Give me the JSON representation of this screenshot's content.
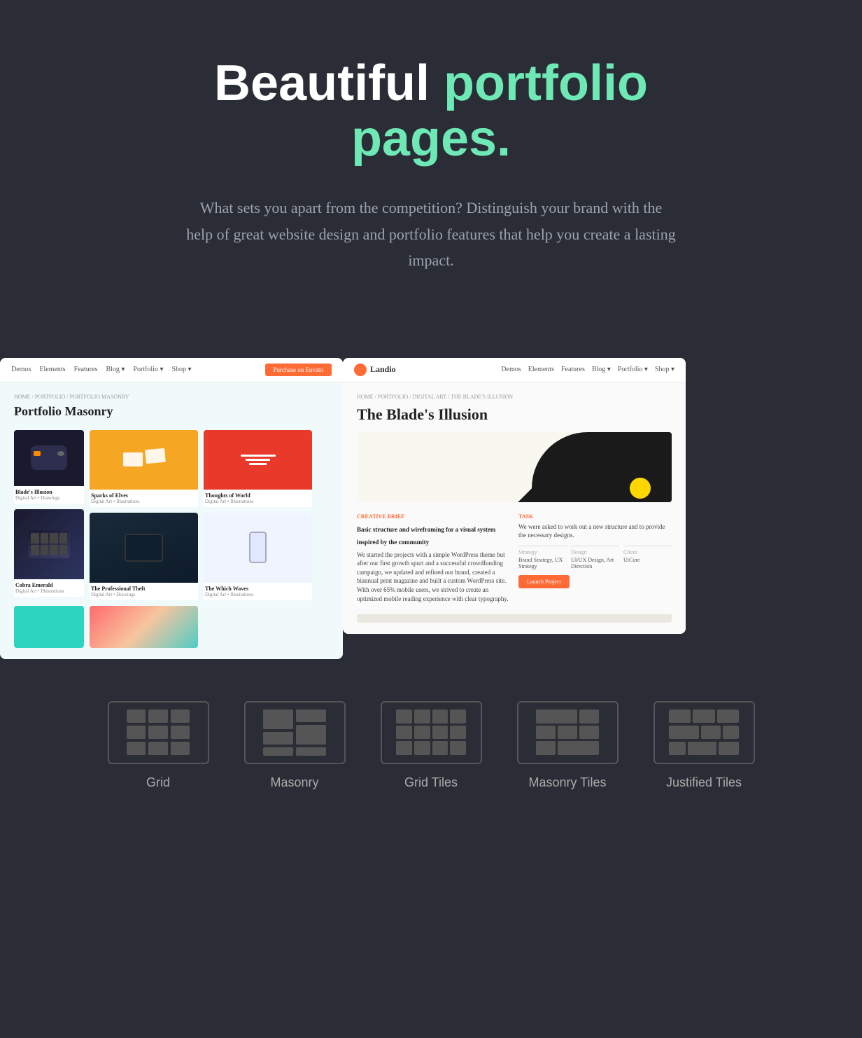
{
  "hero": {
    "title_white": "Beautiful ",
    "title_green": "portfolio pages.",
    "description": "What sets you apart from the competition? Distinguish your brand with the help of great website design and portfolio features that help you create a lasting impact."
  },
  "left_screenshot": {
    "nav_items": [
      "Demos",
      "Elements",
      "Features",
      "Blog ▾",
      "Portfolio ▾",
      "Shop ▾"
    ],
    "cta_label": "Purchase on Envato",
    "breadcrumb": "HOME / PORTFOLIO / PORTFOLIO MASONRY",
    "page_title": "Portfolio Masonry",
    "items": [
      {
        "title": "Sparks of Elves",
        "subtitle": "Digital Art • Illustrations"
      },
      {
        "title": "Thoughts of World",
        "subtitle": "Digital Art • Illustrations"
      },
      {
        "title": "Blade's Illusion",
        "subtitle": "Digital Art • Drawings"
      },
      {
        "title": "The Which Waves",
        "subtitle": "Digital Art • Illustrations"
      },
      {
        "title": "The Professional Theft",
        "subtitle": "Digital Art • Drawings"
      },
      {
        "title": "Cobra Emerald",
        "subtitle": "Digital Art • Illustrations"
      }
    ]
  },
  "right_screenshot": {
    "logo_text": "Landio",
    "nav_items": [
      "Demos",
      "Elements",
      "Features",
      "Blog ▾",
      "Portfolio ▾",
      "Shop ▾"
    ],
    "breadcrumb": "HOME / PORTFOLIO / DIGITAL ART / THE BLADE'S ILLUSION",
    "page_title": "The Blade's Illusion",
    "section1_label": "CREATIVE BRIEF",
    "section1_title": "Basic structure and wireframing for a visual system inspired by the community",
    "section1_body": "We started the projects with a simple WordPress theme but after our first growth spurt and a successful crowdfunding campaign, we updated and refined our brand, created a biannual print magazine and built a custom WordPress site. With over 65% mobile users, we strived to create an optimized mobile reading experience with clear typography.",
    "section2_label": "TASK",
    "section2_body": "We were asked to work out a new structure and to provide the necessary designs.",
    "strategy_label": "Strategy",
    "strategy_value": "Brand Strategy, UX Strategy",
    "design_label": "Design",
    "design_value": "UI/UX Design, Art Direction",
    "client_label": "Client",
    "client_value": "UiCore",
    "launch_btn": "Launch Project"
  },
  "layouts": [
    {
      "id": "grid",
      "label": "Grid"
    },
    {
      "id": "masonry",
      "label": "Masonry"
    },
    {
      "id": "grid-tiles",
      "label": "Grid Tiles"
    },
    {
      "id": "masonry-tiles",
      "label": "Masonry Tiles"
    },
    {
      "id": "justified-tiles",
      "label": "Justified Tiles"
    }
  ],
  "colors": {
    "bg": "#2a2d35",
    "green_accent": "#6ee8b4",
    "orange": "#ff6b35",
    "text_muted": "#9ca3af"
  }
}
